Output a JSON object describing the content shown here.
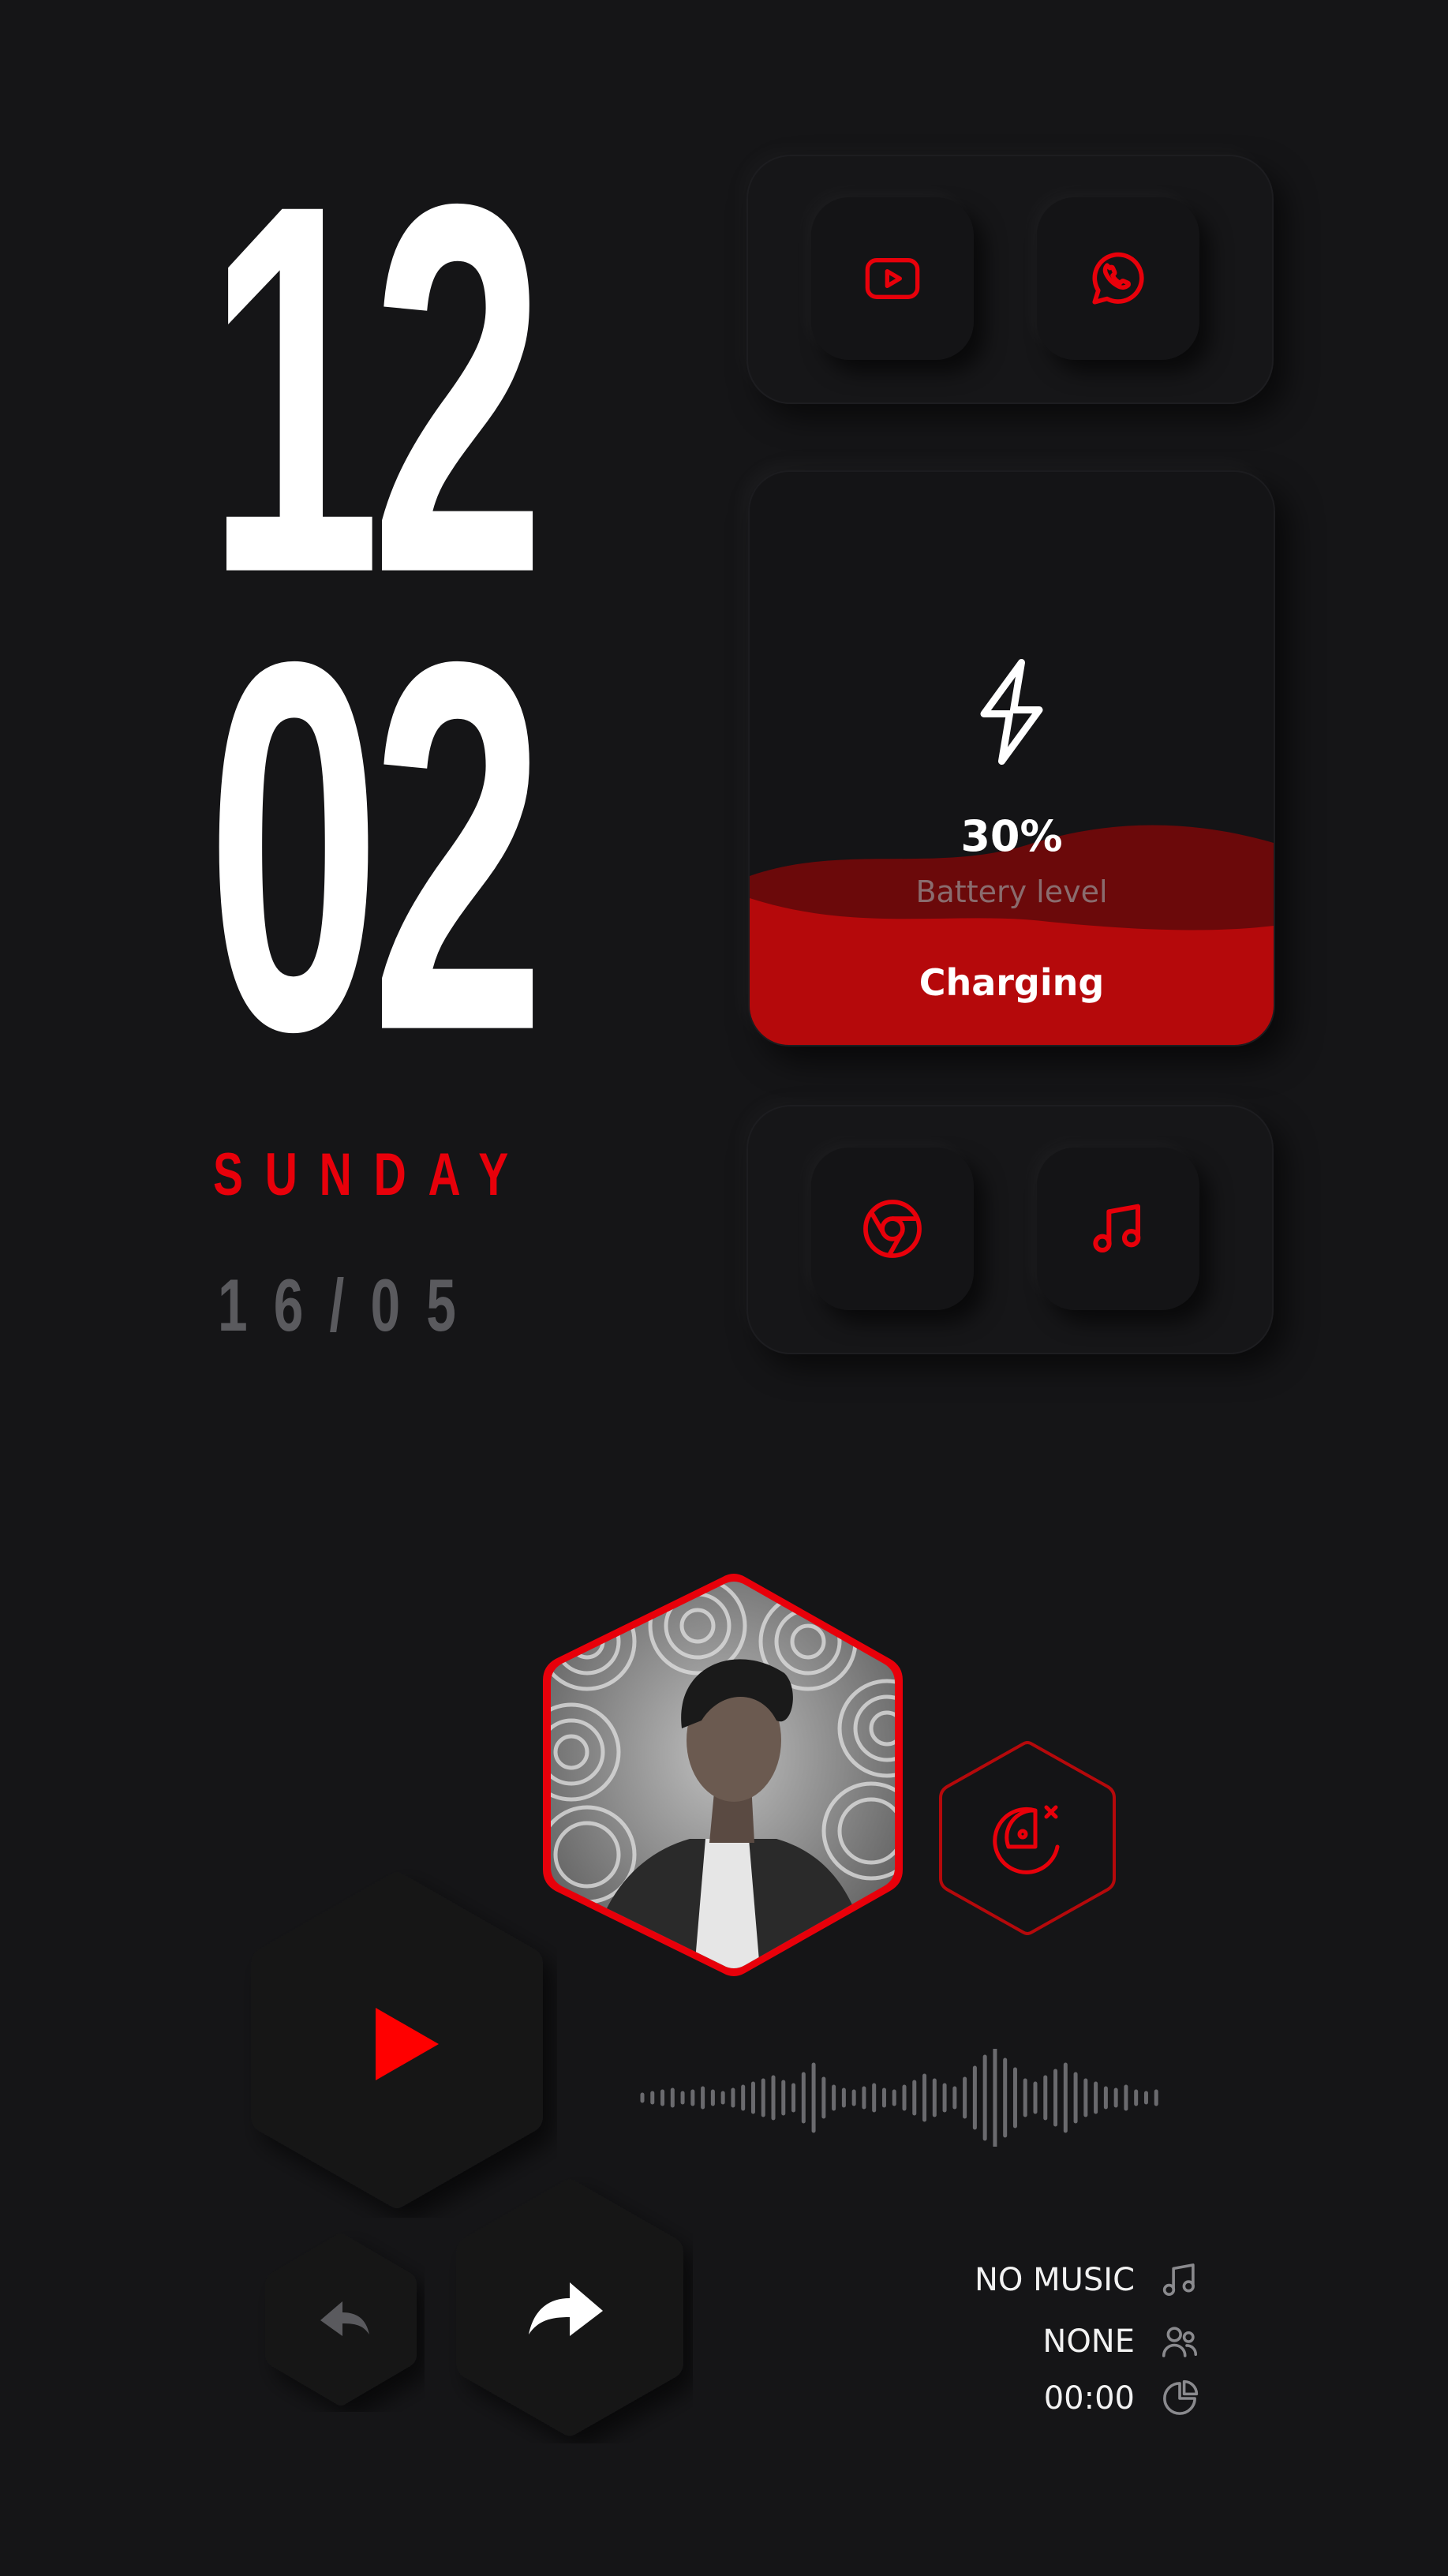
{
  "clock": {
    "hour": "12",
    "minute": "02",
    "day": "SUNDAY",
    "date": "16/05"
  },
  "shortcuts_top": [
    {
      "name": "youtube",
      "icon": "youtube-icon"
    },
    {
      "name": "whatsapp",
      "icon": "whatsapp-icon"
    }
  ],
  "shortcuts_bottom": [
    {
      "name": "chrome",
      "icon": "chrome-icon"
    },
    {
      "name": "music",
      "icon": "music-note-icon"
    }
  ],
  "battery": {
    "percent_text": "30%",
    "label": "Battery level",
    "status": "Charging",
    "level": 0.3,
    "icon": "lightning-icon"
  },
  "player": {
    "avatar_icon": "profile-photo",
    "action_icon": "pizza-icon",
    "play_icon": "play-icon",
    "prev_icon": "back-arrow-icon",
    "next_icon": "forward-arrow-icon",
    "track": "NO MUSIC",
    "artist": "NONE",
    "time": "00:00"
  },
  "colors": {
    "background": "#151517",
    "accent": "#e8000a",
    "battery_fill": "#b5090b",
    "muted": "#5a5a5e"
  }
}
